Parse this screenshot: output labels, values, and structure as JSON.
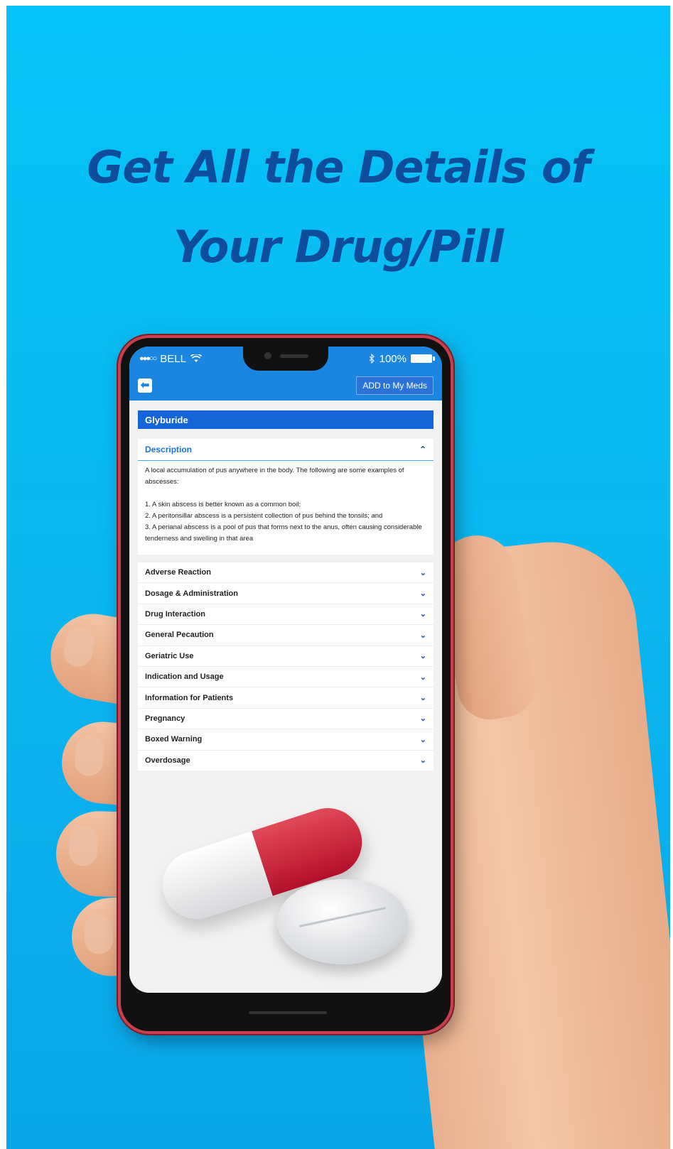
{
  "promo": {
    "headline_line1": "Get All the Details of",
    "headline_line2": "Your Drug/Pill"
  },
  "status_bar": {
    "signal": "●●●○○",
    "carrier": "BELL",
    "wifi_icon": "wifi-icon",
    "bluetooth_icon": "bluetooth-icon",
    "battery_percent": "100%"
  },
  "app_bar": {
    "back_icon": "back-arrow-icon",
    "add_button": "ADD to My Meds"
  },
  "drug": {
    "name": "Glyburide"
  },
  "description": {
    "label": "Description",
    "text": "A local accumulation of pus anywhere in the body. The following are some examples of abscesses:\n\n1. A skin abscess is better known as a common boil;\n2. A peritonsillar abscess is a persistent collection of pus behind the tonsils; and\n3. A perianal abscess is a pool of pus that forms next to the anus, often causing considerable tenderness and swelling in that area"
  },
  "sections": [
    {
      "label": "Adverse Reaction"
    },
    {
      "label": "Dosage & Administration"
    },
    {
      "label": "Drug Interaction"
    },
    {
      "label": "General Pecaution"
    },
    {
      "label": "Geriatric Use"
    },
    {
      "label": "Indication and Usage"
    },
    {
      "label": "Information for Patients"
    },
    {
      "label": "Pregnancy"
    },
    {
      "label": "Boxed Warning"
    },
    {
      "label": "Overdosage"
    }
  ],
  "colors": {
    "background": "#05c3f8",
    "headline": "#0d4d9c",
    "app_primary": "#1a86e0",
    "title_bar": "#1565d8",
    "phone_frame": "#c8404c"
  }
}
